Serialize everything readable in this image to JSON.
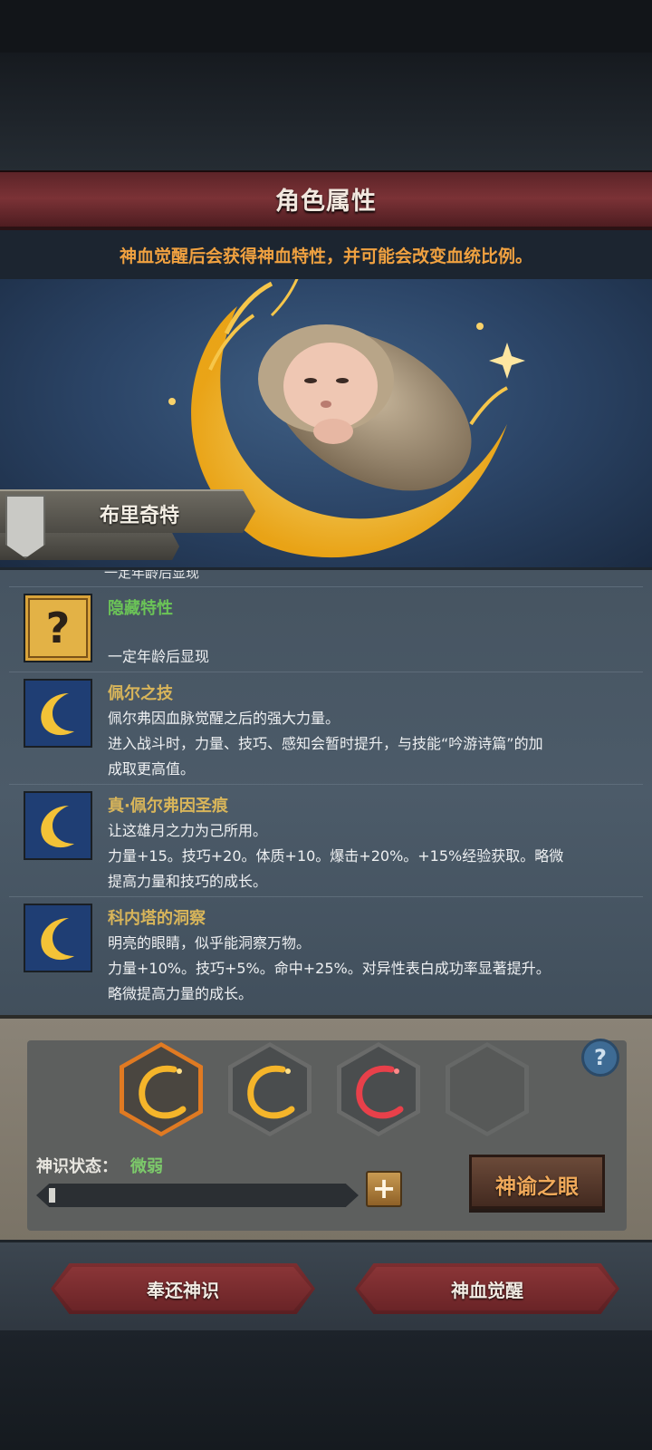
{
  "header": {
    "title": "角色属性",
    "notice": "神血觉醒后会获得神血特性，并可能会改变血统比例。"
  },
  "character": {
    "name": "布里奇特"
  },
  "traits": {
    "cut_off_line": "一定年龄后显现",
    "items": [
      {
        "name": "隐藏特性",
        "icon": "question-mark-icon",
        "lines": [
          "",
          "一定年龄后显现"
        ]
      },
      {
        "name": "佩尔之技",
        "icon": "crescent-moon-icon",
        "lines": [
          "佩尔弗因血脉觉醒之后的强大力量。",
          "进入战斗时，力量、技巧、感知会暂时提升，与技能“吟游诗篇”的加",
          "成取更高值。"
        ]
      },
      {
        "name": "真·佩尔弗因圣痕",
        "icon": "crescent-moon-icon",
        "lines": [
          "让这雄月之力为己所用。",
          "力量+15。技巧+20。体质+10。爆击+20%。+15%经验获取。略微",
          "提高力量和技巧的成长。"
        ]
      },
      {
        "name": "科内塔的洞察",
        "icon": "crescent-moon-icon",
        "lines": [
          "明亮的眼睛，似乎能洞察万物。",
          "力量+10%。技巧+5%。命中+25%。对异性表白成功率显著提升。",
          "略微提高力量的成长。"
        ]
      }
    ]
  },
  "deity": {
    "slots": [
      {
        "icon": "golden-crescent-icon",
        "state": "selected",
        "color": "#f5b52a"
      },
      {
        "icon": "golden-crescent-icon",
        "state": "normal",
        "color": "#f5b52a"
      },
      {
        "icon": "red-crescent-icon",
        "state": "normal",
        "color": "#e8404a"
      },
      {
        "icon": "empty-slot",
        "state": "empty",
        "color": ""
      }
    ],
    "status_label": "神识状态：",
    "status_value": "微弱",
    "progress": 0.02,
    "oracle_button": "神谕之眼"
  },
  "actions": {
    "return_button": "奉还神识",
    "awaken_button": "神血觉醒"
  },
  "colors": {
    "title_bar": "#7b3236",
    "notice_text": "#f0a140",
    "trait_name": "#d8b55a",
    "hidden_trait_name": "#6bc457",
    "status_value": "#7cc96a"
  }
}
